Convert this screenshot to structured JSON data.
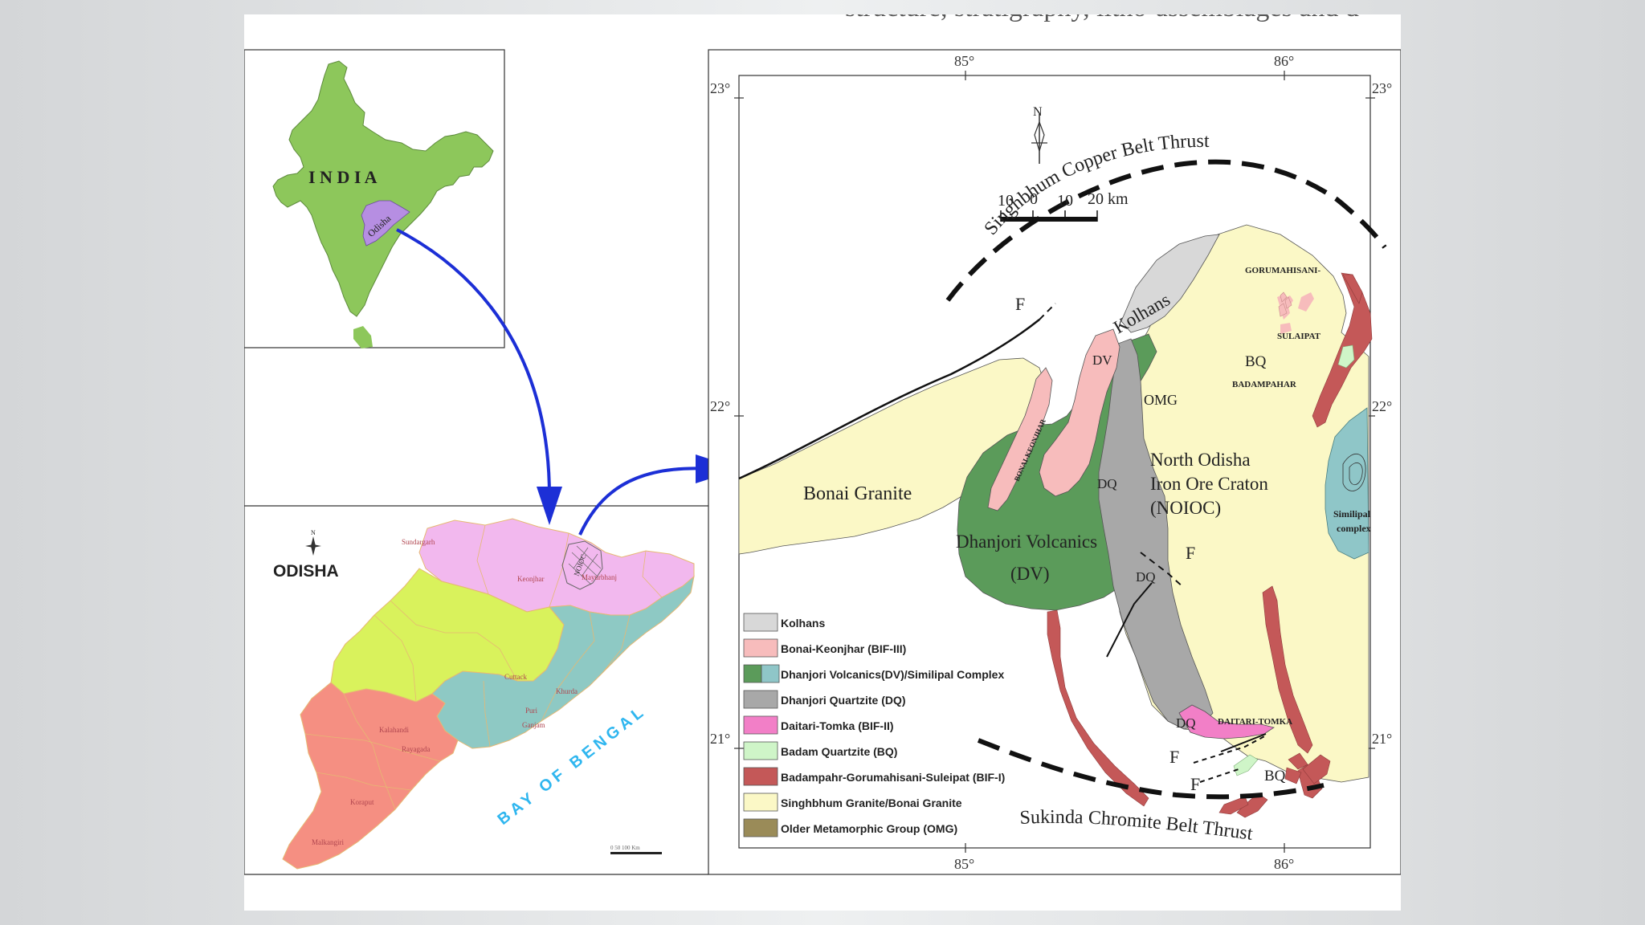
{
  "page": {
    "cropped_header_text": "structure, stratigraphy, litho-assemblages and d"
  },
  "india_panel": {
    "country_label": "I N D I A",
    "state_label": "Odisha",
    "colors": {
      "land": "#8dc75b",
      "state": "#b68ee2",
      "outline": "#5d8a3c"
    }
  },
  "odisha_panel": {
    "title": "ODISHA",
    "north_label": "N",
    "sea_label": "BAY OF BENGAL",
    "district_labels": [
      "Sundargarh",
      "Mayurbhanj",
      "Keonjhar",
      "NOIOC",
      "Cuttack",
      "Khurda",
      "Ganjam",
      "Puri",
      "Kalahandi",
      "Rayagada",
      "Koraput",
      "Malkangiri"
    ],
    "scale_label": "0    50    100 Km",
    "colors": {
      "north": "#f2b8ee",
      "central": "#d9f25c",
      "coastal": "#8ec9c4",
      "south": "#f58f82",
      "sea_text": "#2fb6ef"
    }
  },
  "arrow_color": "#1c2fd6",
  "geo_map": {
    "lat_labels": {
      "top": "23°",
      "mid": "22°",
      "bottom": "21°"
    },
    "lon_labels": {
      "left": "85°",
      "right": "86°"
    },
    "north_label": "N",
    "scale_labels": [
      "10",
      "0",
      "10",
      "20 km"
    ],
    "thrusts": {
      "north": "Singhbhum Copper Belt Thrust",
      "south": "Sukinda Chromite Belt Thrust"
    },
    "unit_labels": {
      "bonai_granite": "Bonai Granite",
      "dhanjori_line1": "Dhanjori Volcanics",
      "dhanjori_line2": "(DV)",
      "noioc_line1": "North Odisha",
      "noioc_line2": "Iron Ore Craton",
      "noioc_line3": "(NOIOC)",
      "kolhans": "Kolhans",
      "dv": "DV",
      "omg": "OMG",
      "dq1": "DQ",
      "dq2": "DQ",
      "dq3": "DQ",
      "bq1": "BQ",
      "bq2": "BQ",
      "bonai_keonjhar": "BONAI-KEONJHAR",
      "gorumahisani": "GORUMAHISANI-",
      "sulaipat": "SULAIPAT",
      "badampahar": "BADAMPAHAR",
      "daitari_tomka": "DAITARI-TOMKA",
      "similipal_line1": "Similipal",
      "similipal_line2": "complex",
      "fault": "F"
    },
    "colors": {
      "kolhans": "#d8d8d8",
      "bonai_keonjhar": "#f7bcbc",
      "dhanjori": "#5b9b5a",
      "similipal": "#8fc6c8",
      "dq": "#a8a8a8",
      "daitari": "#f27fc7",
      "badam_q": "#cff5c8",
      "bif1": "#c45858",
      "granite": "#fbf8c6",
      "omg": "#9a8b58"
    },
    "legend": [
      {
        "label": "Kolhans",
        "colors": [
          "#d8d8d8"
        ]
      },
      {
        "label": "Bonai-Keonjhar (BIF-III)",
        "colors": [
          "#f7bcbc"
        ]
      },
      {
        "label": "Dhanjori Volcanics(DV)/Similipal Complex",
        "colors": [
          "#5b9b5a",
          "#8fc6c8"
        ]
      },
      {
        "label": "Dhanjori Quartzite (DQ)",
        "colors": [
          "#a8a8a8"
        ]
      },
      {
        "label": "Daitari-Tomka (BIF-II)",
        "colors": [
          "#f27fc7"
        ]
      },
      {
        "label": "Badam Quartzite (BQ)",
        "colors": [
          "#cff5c8"
        ]
      },
      {
        "label": "Badampahr-Gorumahisani-Suleipat (BIF-I)",
        "colors": [
          "#c45858"
        ]
      },
      {
        "label": "Singhbhum Granite/Bonai Granite",
        "colors": [
          "#fbf8c6"
        ]
      },
      {
        "label": "Older Metamorphic Group (OMG)",
        "colors": [
          "#9a8b58"
        ]
      }
    ]
  }
}
